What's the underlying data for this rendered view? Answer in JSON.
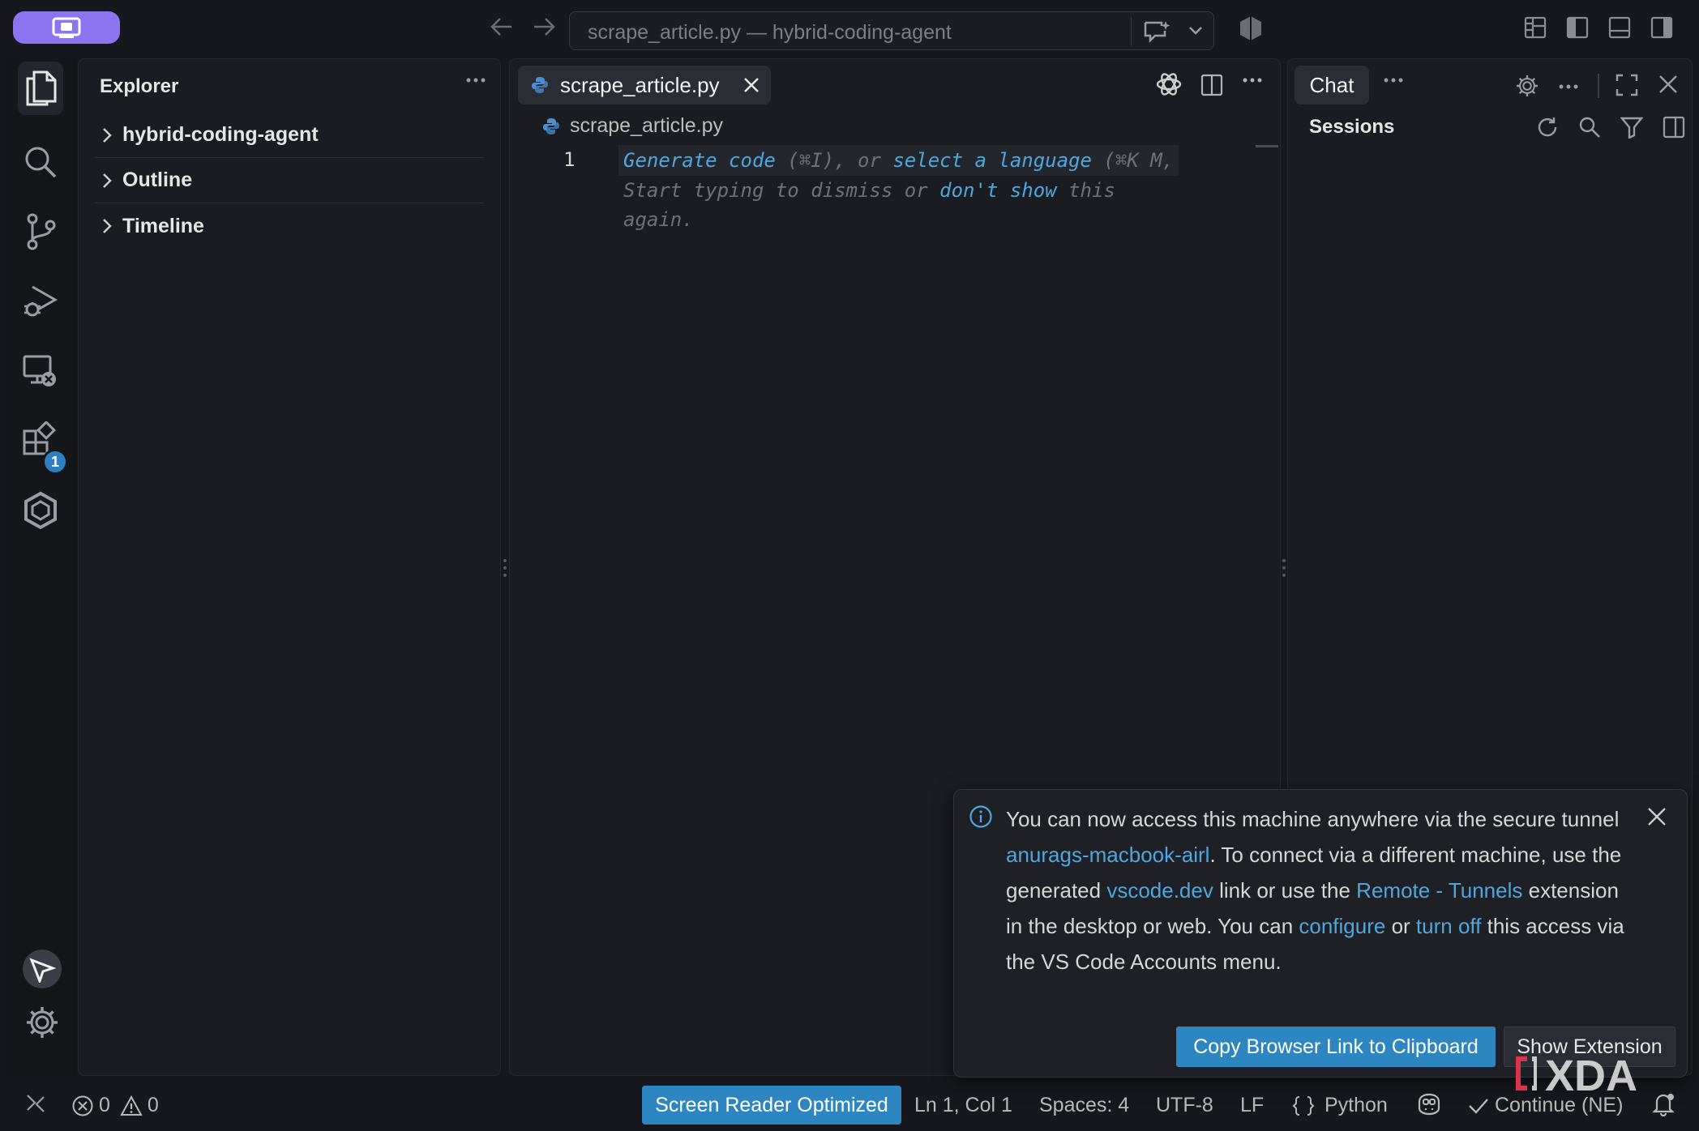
{
  "window": {
    "title": "scrape_article.py — hybrid-coding-agent"
  },
  "sidebar": {
    "title": "Explorer",
    "sections": [
      {
        "label": "hybrid-coding-agent"
      },
      {
        "label": "Outline"
      },
      {
        "label": "Timeline"
      }
    ]
  },
  "activity_bar": {
    "extensions_badge": "1"
  },
  "editor": {
    "tab_label": "scrape_article.py",
    "breadcrumb": "scrape_article.py",
    "line_number": "1",
    "hint": {
      "generate": "Generate code",
      "generate_key": " (⌘I), or ",
      "select_language": "select a language",
      "select_key": " (⌘K M,",
      "line2_a": "Start typing to dismiss or ",
      "dont_show": "don't show",
      "line2_b": " this",
      "line3": "again."
    }
  },
  "chat": {
    "tab_label": "Chat",
    "sessions_label": "Sessions"
  },
  "notification": {
    "t1": "You can now access this machine anywhere via the secure tunnel ",
    "link_machine": "anurags-macbook-airl",
    "t2": ". To connect via a different machine, use the generated ",
    "link_vscode": "vscode.dev",
    "t3": " link or use the ",
    "link_tunnels": "Remote - Tunnels",
    "t4": " extension in the desktop or web. You can ",
    "link_configure": "configure",
    "t5": " or ",
    "link_turnoff": "turn off",
    "t6": " this access via the VS Code Accounts menu.",
    "copy_button": "Copy Browser Link to Clipboard",
    "show_button": "Show Extension"
  },
  "statusbar": {
    "errors": "0",
    "warnings": "0",
    "screen_reader": "Screen Reader Optimized",
    "cursor": "Ln 1, Col 1",
    "spaces": "Spaces: 4",
    "encoding": "UTF-8",
    "eol": "LF",
    "language": "Python",
    "continue": "Continue (NE)"
  },
  "watermark": "XDA",
  "colors": {
    "accent_blue": "#2e86c1",
    "link_blue": "#4ea7dd",
    "remote_purple": "#8b74f0",
    "background": "#16181d"
  },
  "icons": [
    "remote-icon",
    "back-arrow-icon",
    "forward-arrow-icon",
    "chat-sparkle-icon",
    "chevron-down-icon",
    "accounts-shield-icon",
    "layout-icon",
    "toggle-sidebar-icon",
    "toggle-panel-icon",
    "toggle-secondary-sidebar-icon",
    "files-icon",
    "search-icon",
    "source-control-icon",
    "run-debug-icon",
    "remote-explorer-icon",
    "extensions-icon",
    "continue-icon",
    "account-icon",
    "gear-icon",
    "python-icon",
    "close-icon",
    "openai-icon",
    "split-editor-icon",
    "more-icon",
    "refresh-icon",
    "filter-icon",
    "maximize-icon",
    "info-icon",
    "error-icon",
    "warning-icon",
    "copilot-icon",
    "check-icon",
    "bell-icon"
  ]
}
